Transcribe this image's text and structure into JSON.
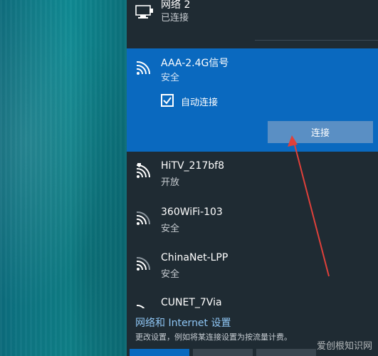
{
  "networks": [
    {
      "name": "网络 2",
      "status": "已连接",
      "icon": "ethernet-icon"
    },
    {
      "name": "AAA-2.4G信号",
      "status": "安全",
      "icon": "wifi-icon",
      "selected": true,
      "auto_connect_label": "自动连接",
      "auto_connect_checked": true,
      "connect_label": "连接"
    },
    {
      "name": "HiTV_217bf8",
      "status": "开放",
      "icon": "wifi-shield-icon"
    },
    {
      "name": "360WiFi-103",
      "status": "安全",
      "icon": "wifi-icon"
    },
    {
      "name": "ChinaNet-LPP",
      "status": "安全",
      "icon": "wifi-icon"
    },
    {
      "name": "CUNET_7Via",
      "status": "",
      "icon": "wifi-icon"
    }
  ],
  "footer": {
    "settings_link": "网络和 Internet 设置",
    "description": "更改设置，例如将某连接设置为按流量计费。"
  },
  "watermark": "爱创根知识网",
  "colors": {
    "flyout_bg": "#1f2b33",
    "selected_bg": "#0a69bf",
    "connect_button": "#5a8fc4",
    "link": "#8ec5f3",
    "annotation_arrow": "#e0403a"
  }
}
